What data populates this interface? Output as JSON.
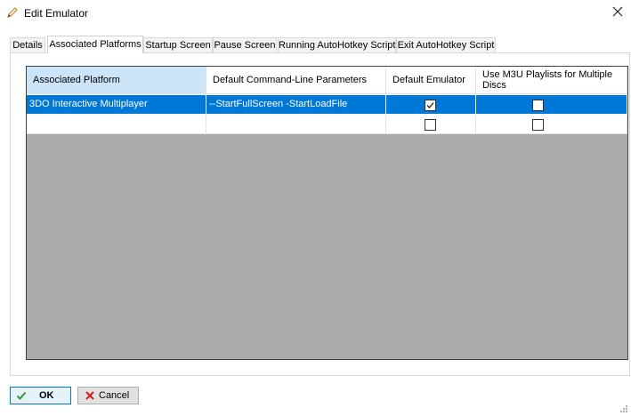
{
  "window": {
    "title": "Edit Emulator",
    "title_icon": "pencil-icon",
    "close_icon": "close-icon"
  },
  "tabs": [
    {
      "label": "Details"
    },
    {
      "label": "Associated Platforms",
      "active": true
    },
    {
      "label": "Startup Screen"
    },
    {
      "label": "Pause Screen"
    },
    {
      "label": "Running AutoHotkey Script"
    },
    {
      "label": "Exit AutoHotkey Script"
    }
  ],
  "grid": {
    "columns": [
      {
        "label": "Associated Platform"
      },
      {
        "label": "Default Command-Line Parameters"
      },
      {
        "label": "Default Emulator"
      },
      {
        "label": "Use M3U Playlists for Multiple Discs"
      }
    ],
    "rows": [
      {
        "platform": "3DO Interactive Multiplayer",
        "params": "--StartFullScreen -StartLoadFile",
        "default_emulator": true,
        "use_m3u": false,
        "selected": true
      },
      {
        "platform": "",
        "params": "",
        "default_emulator": false,
        "use_m3u": false,
        "selected": false
      }
    ],
    "colors": {
      "selection": "#0078d7",
      "header_selected": "#cce4f7",
      "empty_area": "#ababab"
    }
  },
  "buttons": {
    "ok": {
      "label": "OK",
      "icon": "checkmark-icon"
    },
    "cancel": {
      "label": "Cancel",
      "icon": "x-icon"
    }
  }
}
